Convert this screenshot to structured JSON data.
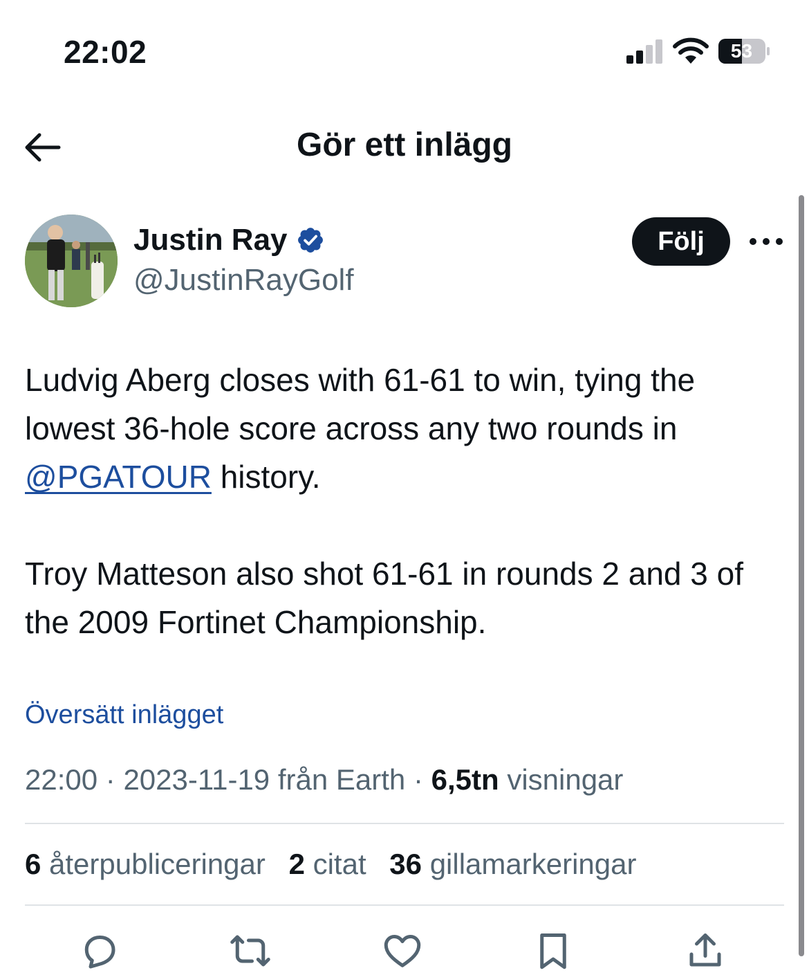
{
  "status_bar": {
    "time": "22:02",
    "battery": "53"
  },
  "nav": {
    "title": "Gör ett inlägg"
  },
  "tweet": {
    "author_name": "Justin Ray",
    "author_handle": "@JustinRayGolf",
    "follow_label": "Följ",
    "body": {
      "para1_text": "Ludvig Aberg closes with 61-61 to win, tying the lowest 36-hole score across any two rounds in",
      "mention": "@PGATOUR",
      "para1_tail": "history.",
      "para2_text": "Troy Matteson also shot 61-61 in rounds 2 and 3 of the 2009 Fortinet Championship."
    },
    "translate_label": "Översätt inlägget",
    "meta": {
      "time": "22:00",
      "date": "2023-11-19",
      "source": "från Earth",
      "views_count": "6,5tn",
      "views_label": "visningar"
    },
    "stats": {
      "reposts_count": "6",
      "reposts_label": "återpubliceringar",
      "quotes_count": "2",
      "quotes_label": "citat",
      "likes_count": "36",
      "likes_label": "gillamarkeringar"
    }
  },
  "colors": {
    "text": "#0f1419",
    "secondary": "#536471",
    "link": "#1d4e9e",
    "verified": "#1d4e9e",
    "divider": "#dfe3e6"
  },
  "icons": {
    "back": "arrow-left-icon",
    "verified": "verified-badge-icon",
    "more": "more-horizontal-icon",
    "reply": "comment-bubble-icon",
    "repost": "repost-arrows-icon",
    "like": "heart-icon",
    "bookmark": "bookmark-icon",
    "share": "share-upload-icon"
  }
}
